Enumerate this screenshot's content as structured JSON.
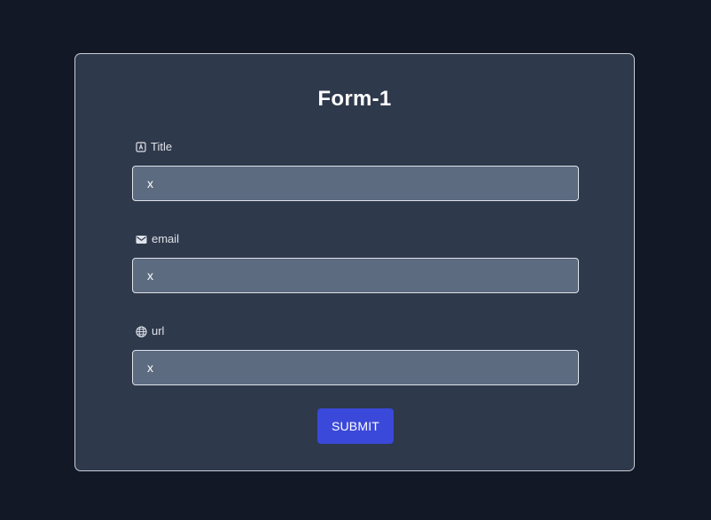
{
  "form": {
    "title": "Form-1",
    "fields": [
      {
        "label": "Title",
        "value": "x",
        "icon": "text-field-icon"
      },
      {
        "label": "email",
        "value": "x",
        "icon": "mail-icon"
      },
      {
        "label": "url",
        "value": "x",
        "icon": "globe-icon"
      }
    ],
    "submit_label": "SUBMIT"
  }
}
